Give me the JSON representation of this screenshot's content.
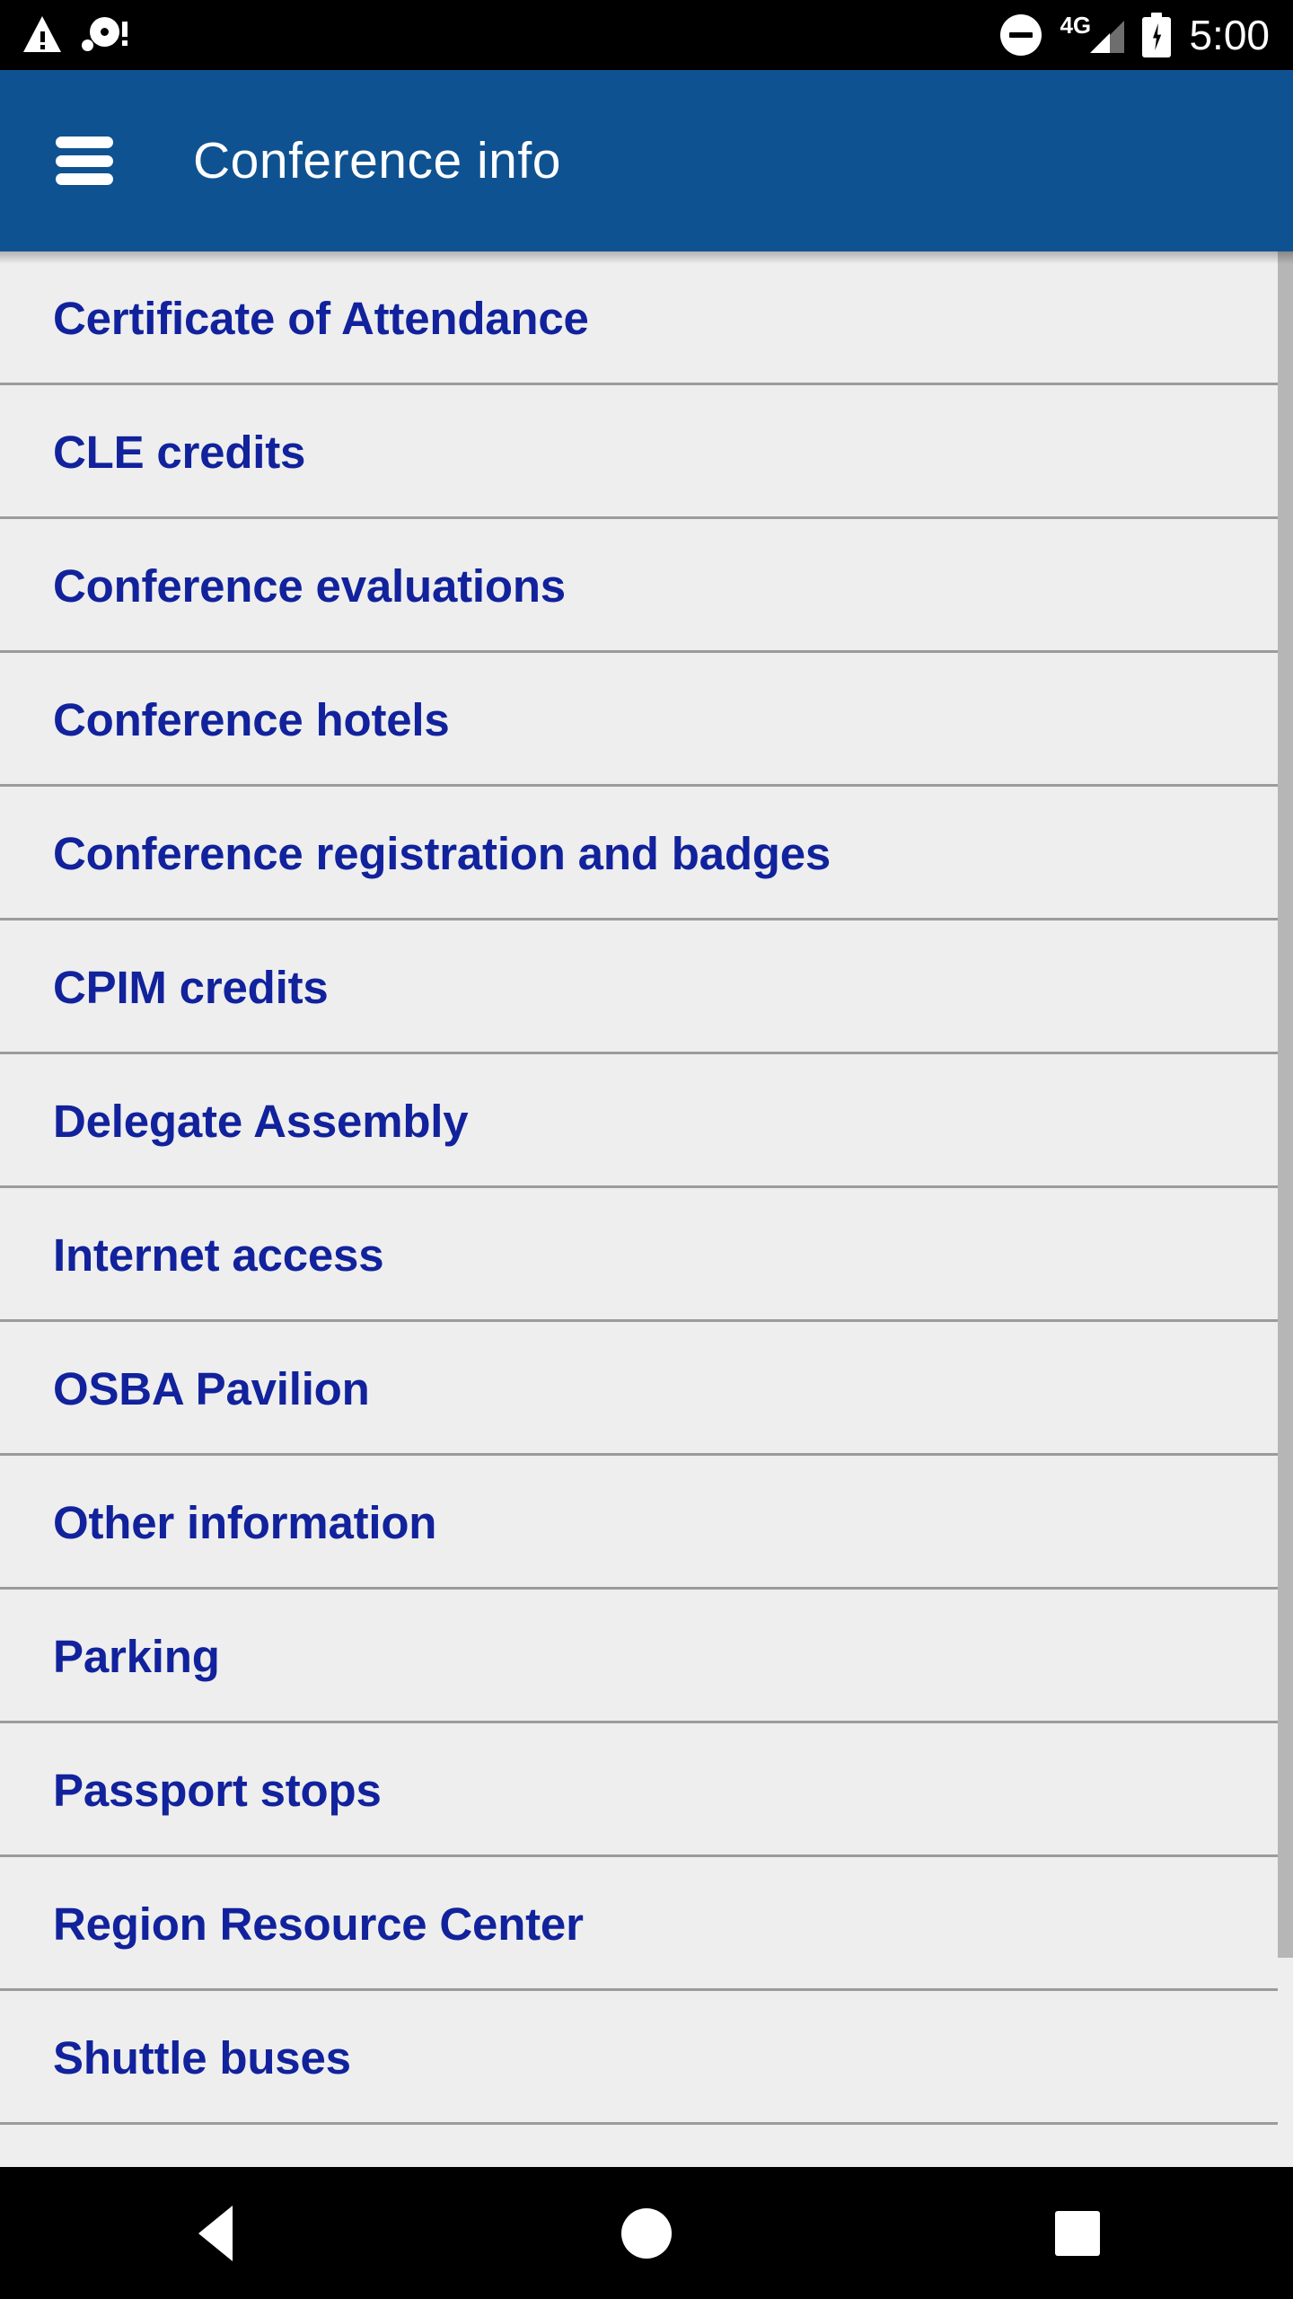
{
  "status_bar": {
    "time": "5:00",
    "network_generation": "4G",
    "icons": {
      "warning": "warning-triangle-icon",
      "notification": "notification-alert-icon",
      "dnd": "do-not-disturb-icon",
      "signal": "cellular-signal-icon",
      "battery": "battery-charging-icon"
    }
  },
  "app_bar": {
    "title": "Conference info",
    "menu_icon": "hamburger-menu-icon",
    "background_color": "#0f5291",
    "text_color": "#ffffff"
  },
  "list": {
    "item_text_color": "#11229c",
    "background_color": "#eeeeee",
    "divider_color": "#9b9b9b",
    "items": [
      {
        "label": "Certificate of Attendance"
      },
      {
        "label": "CLE credits"
      },
      {
        "label": "Conference evaluations"
      },
      {
        "label": "Conference hotels"
      },
      {
        "label": "Conference registration and badges"
      },
      {
        "label": "CPIM credits"
      },
      {
        "label": "Delegate Assembly"
      },
      {
        "label": "Internet access"
      },
      {
        "label": "OSBA Pavilion"
      },
      {
        "label": "Other information"
      },
      {
        "label": "Parking"
      },
      {
        "label": "Passport stops"
      },
      {
        "label": "Region Resource Center"
      },
      {
        "label": "Shuttle buses"
      },
      {
        "label": ""
      }
    ]
  },
  "scrollbar": {
    "thumb_color": "#b6b6b6"
  },
  "nav_bar": {
    "back_label": "back-button",
    "home_label": "home-button",
    "recents_label": "recents-button",
    "background_color": "#000000"
  }
}
